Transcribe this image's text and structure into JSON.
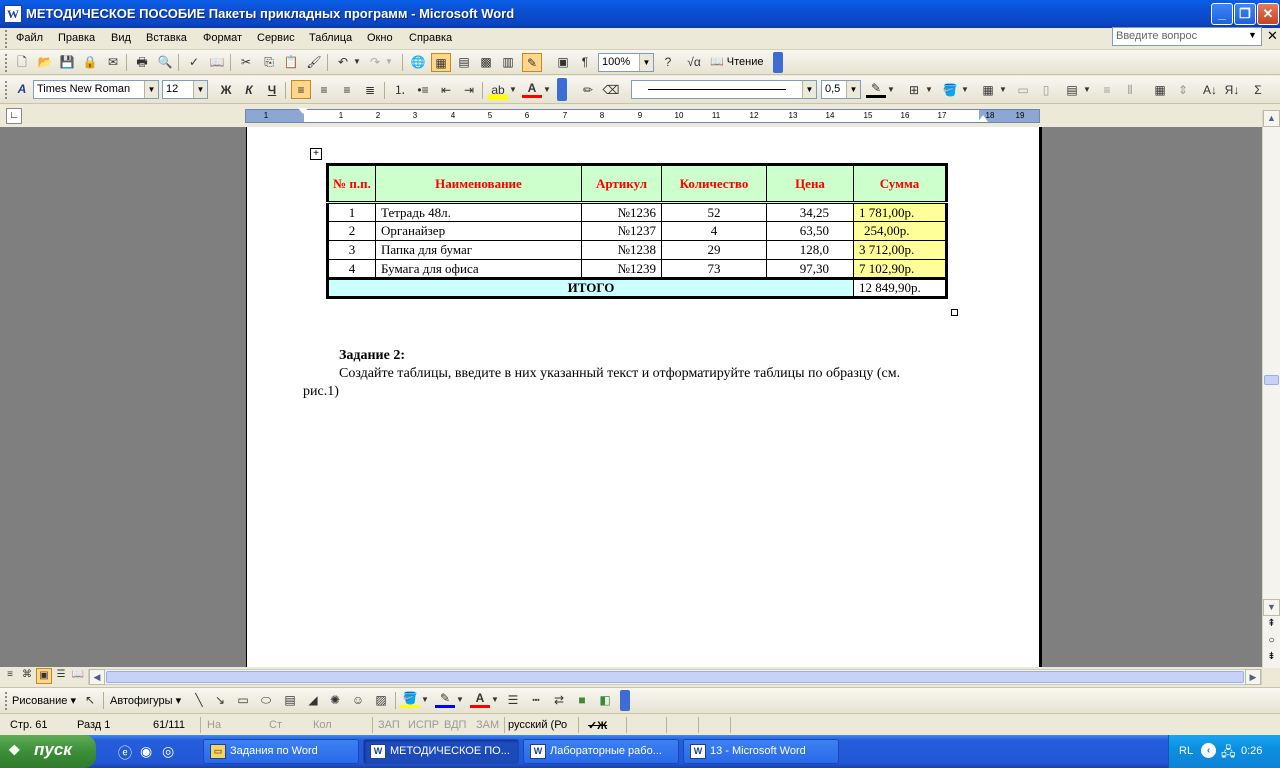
{
  "window": {
    "title": "МЕТОДИЧЕСКОЕ ПОСОБИЕ Пакеты прикладных программ - Microsoft Word",
    "icon": "W"
  },
  "menu": {
    "items": [
      "Файл",
      "Правка",
      "Вид",
      "Вставка",
      "Формат",
      "Сервис",
      "Таблица",
      "Окно",
      "Справка"
    ],
    "ask_placeholder": "Введите вопрос"
  },
  "standard": {
    "zoom": "100%",
    "reading_label": "Чтение"
  },
  "formatting": {
    "font": "Times New Roman",
    "size": "12",
    "bold": "Ж",
    "italic": "К",
    "underline": "Ч",
    "line_weight": "0,5"
  },
  "ruler": {
    "numbers": [
      "1",
      "1",
      "2",
      "3",
      "4",
      "5",
      "6",
      "7",
      "8",
      "9",
      "10",
      "11",
      "12",
      "13",
      "14",
      "15",
      "16",
      "17",
      "18",
      "19"
    ]
  },
  "doc_table": {
    "headers": [
      "№ п.п.",
      "Наименование",
      "Артикул",
      "Количество",
      "Цена",
      "Сумма"
    ],
    "rows": [
      {
        "n": "1",
        "name": "Тетрадь 48л.",
        "art": "№1236",
        "qty": "52",
        "price": "34,25",
        "sum": "1 781,00р."
      },
      {
        "n": "2",
        "name": "Органайзер",
        "art": "№1237",
        "qty": "4",
        "price": "63,50",
        "sum": "254,00р."
      },
      {
        "n": "3",
        "name": "Папка для бумаг",
        "art": "№1238",
        "qty": "29",
        "price": "128,0",
        "sum": "3 712,00р."
      },
      {
        "n": "4",
        "name": "Бумага для офиса",
        "art": "№1239",
        "qty": "73",
        "price": "97,30",
        "sum": "7 102,90р."
      }
    ],
    "total_label": "ИТОГО",
    "total_sum": "12 849,90р."
  },
  "doc_text": {
    "task_title": "Задание 2:",
    "line1": "Создайте таблицы, введите в них указанный текст и отформатируйте таблицы по образцу (см.",
    "line2": "рис.1)"
  },
  "drawing": {
    "draw_label": "Рисование",
    "autoshapes_label": "Автофигуры"
  },
  "status": {
    "page": "Стр. 61",
    "section": "Разд 1",
    "pages": "61/111",
    "at": "На",
    "ln": "Ст",
    "col": "Кол",
    "rec": "ЗАП",
    "trk": "ИСПР",
    "ext": "ВДП",
    "ovr": "ЗАМ",
    "lang": "русский (Ро"
  },
  "taskbar": {
    "start": "пуск",
    "tasks": [
      "Задания по Word",
      "МЕТОДИЧЕСКОЕ ПО...",
      "Лабораторные рабо...",
      "13 - Microsoft Word"
    ],
    "lang": "RL",
    "clock": "0:26"
  }
}
